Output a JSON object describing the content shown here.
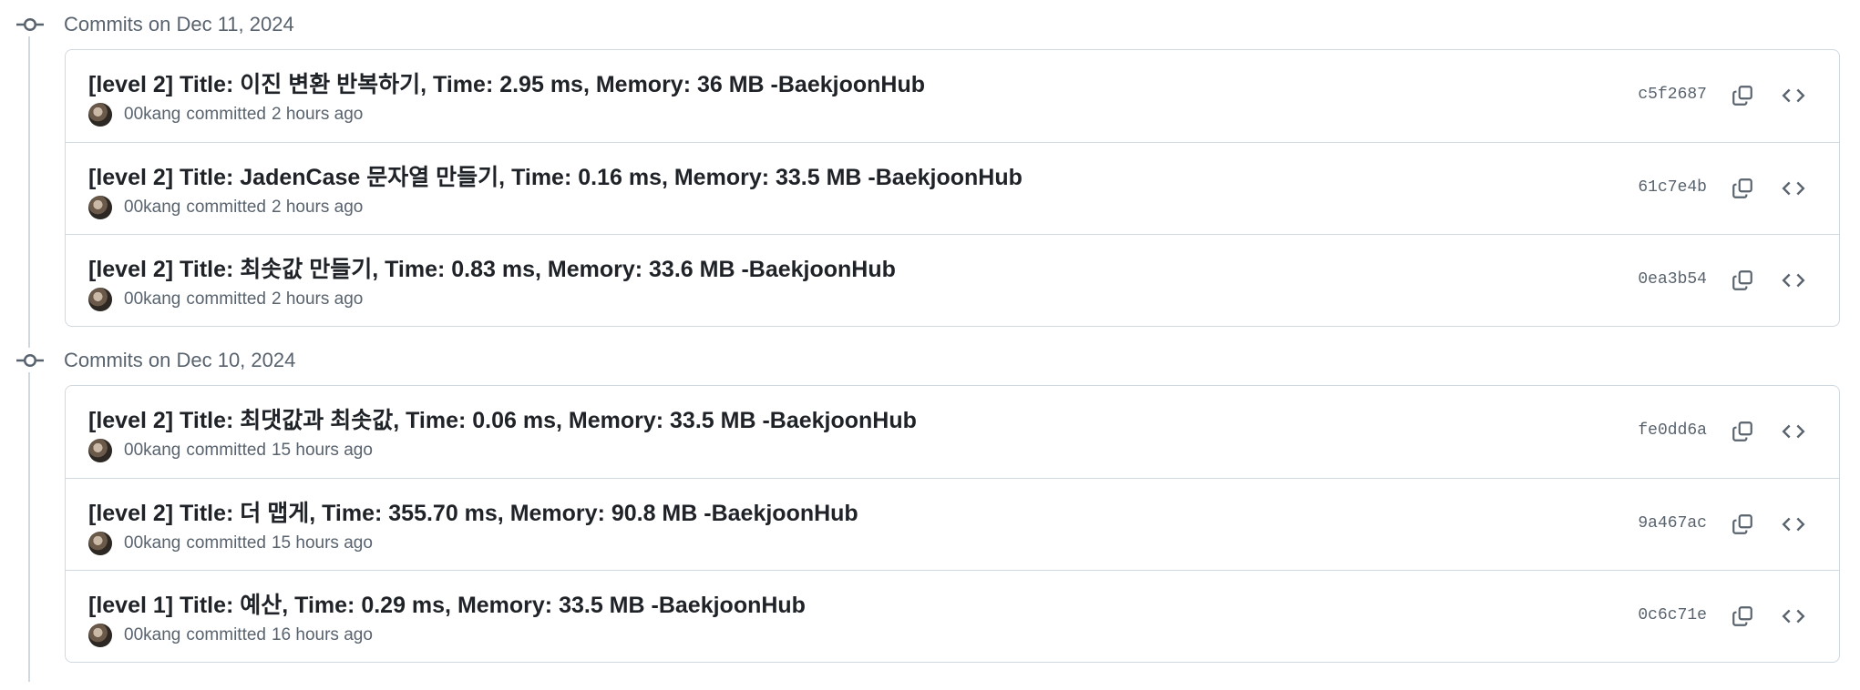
{
  "groups": [
    {
      "date_label": "Commits on Dec 11, 2024",
      "commits": [
        {
          "title": "[level 2] Title: 이진 변환 반복하기, Time: 2.95 ms, Memory: 36 MB -BaekjoonHub",
          "author": "00kang",
          "action": "committed",
          "time": "2 hours ago",
          "sha": "c5f2687"
        },
        {
          "title": "[level 2] Title: JadenCase 문자열 만들기, Time: 0.16 ms, Memory: 33.5 MB -BaekjoonHub",
          "author": "00kang",
          "action": "committed",
          "time": "2 hours ago",
          "sha": "61c7e4b"
        },
        {
          "title": "[level 2] Title: 최솟값 만들기, Time: 0.83 ms, Memory: 33.6 MB -BaekjoonHub",
          "author": "00kang",
          "action": "committed",
          "time": "2 hours ago",
          "sha": "0ea3b54"
        }
      ]
    },
    {
      "date_label": "Commits on Dec 10, 2024",
      "commits": [
        {
          "title": "[level 2] Title: 최댓값과 최솟값, Time: 0.06 ms, Memory: 33.5 MB -BaekjoonHub",
          "author": "00kang",
          "action": "committed",
          "time": "15 hours ago",
          "sha": "fe0dd6a"
        },
        {
          "title": "[level 2] Title: 더 맵게, Time: 355.70 ms, Memory: 90.8 MB -BaekjoonHub",
          "author": "00kang",
          "action": "committed",
          "time": "15 hours ago",
          "sha": "9a467ac"
        },
        {
          "title": "[level 1] Title: 예산, Time: 0.29 ms, Memory: 33.5 MB -BaekjoonHub",
          "author": "00kang",
          "action": "committed",
          "time": "16 hours ago",
          "sha": "0c6c71e"
        }
      ]
    }
  ],
  "icons": {
    "commit": "git-commit-icon",
    "copy": "copy-icon",
    "browse": "code-brackets-icon"
  }
}
